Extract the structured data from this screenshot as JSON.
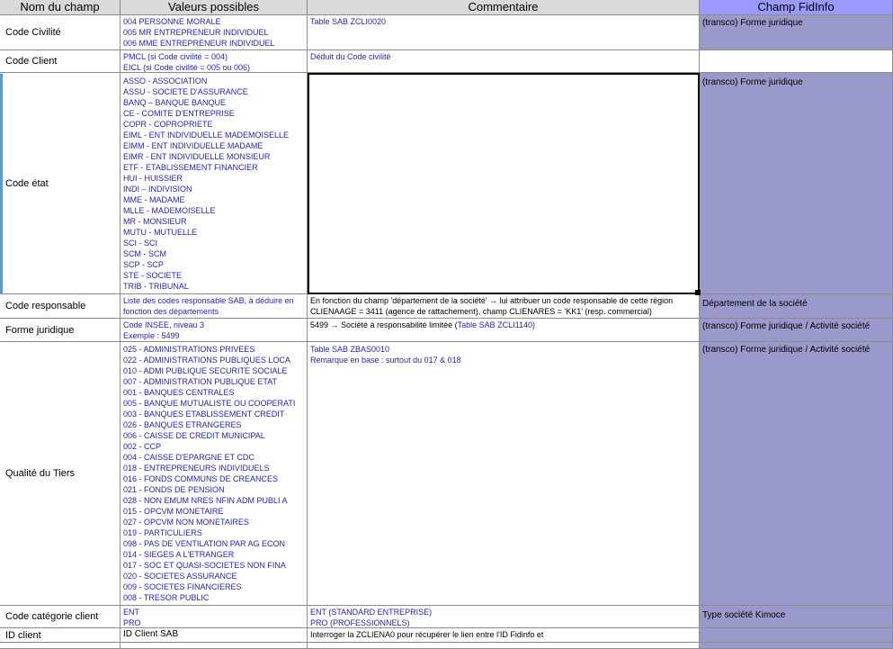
{
  "headers": {
    "name": "Nom du champ",
    "values": "Valeurs possibles",
    "comment": "Commentaire",
    "fidinfo": "Champ FidInfo"
  },
  "rows": {
    "civilite": {
      "name": "Code Civilité",
      "values": [
        "004 PERSONNE MORALE",
        "005 MR ENTREPRENEUR INDIVIDUEL",
        "006 MME ENTREPRENEUR INDIVIDUEL"
      ],
      "comment": "Table SAB ZCLI0020",
      "fidinfo": "(transco) Forme juridique"
    },
    "client": {
      "name": "Code Client",
      "values": [
        "PMCL (si Code civilité = 004)",
        "EICL (si Code civilité = 005 ou 006)"
      ],
      "comment": "Déduit du Code civilité",
      "fidinfo": ""
    },
    "etat": {
      "name": "Code état",
      "values": [
        "ASSO - ASSOCIATION",
        "ASSU - SOCIETE D'ASSURANCE",
        "BANQ – BANQUE BANQUE",
        "CE - COMITE D'ENTREPRISE",
        "COPR - COPROPRIETE",
        "EIML - ENT INDIVIDUELLE MADEMOISELLE",
        "EIMM - ENT INDIVIDUELLE MADAME",
        "EIMR - ENT INDIVIDUELLE MONSIEUR",
        "ETF - ETABLISSEMENT FINANCIER",
        "HUI - HUISSIER",
        "INDI – INDIVISION",
        "MME - MADAME",
        "MLLE - MADEMOISELLE",
        "MR - MONSIEUR",
        "MUTU - MUTUELLE",
        "SCI - SCI",
        "SCM - SCM",
        "SCP - SCP",
        "STE - SOCIETE",
        "TRIB - TRIBUNAL"
      ],
      "comment": "",
      "fidinfo": "(transco) Forme juridique"
    },
    "responsable": {
      "name": "Code responsable",
      "values": [
        "Liste des codes responsable SAB, à déduire en",
        "fonction des départements"
      ],
      "comment_lines": [
        "En fonction du champ 'département de la société' → lui attribuer un code responsable de cette région",
        "CLIENAAGE = 3411 (agence de rattachement), champ CLIENARES = 'KK1' (resp. commercial)"
      ],
      "fidinfo": "Département de la société"
    },
    "forme": {
      "name": "Forme juridique",
      "values": [
        "Code INSEE, niveau 3",
        "Exemple : 5499"
      ],
      "comment_a": "5499 → Société à responsabilité limitée (",
      "comment_b": "Table SAB ZCLI1140)",
      "fidinfo": "(transco) Forme juridique / Activité société"
    },
    "qualite": {
      "name": "Qualité du Tiers",
      "values": [
        "025 - ADMINISTRATIONS PRIVEES",
        "022 - ADMINISTRATIONS PUBLIQUES LOCA",
        "010 - ADMI PUBLIQUE SECURITE SOCIALE",
        "007 - ADMINISTRATION PUBLIQUE ETAT",
        "001 - BANQUES CENTRALES",
        "005 - BANQUE MUTUALISTE OU COOPERATI",
        "003 - BANQUES ETABLISSEMENT CREDIT",
        "026 - BANQUES ETRANGERES",
        "006 - CAISSE DE CREDIT MUNICIPAL",
        "002 - CCP",
        "004 - CAISSE D'EPARGNE ET CDC",
        "018 - ENTREPRENEURS INDIVIDUELS",
        "016 - FONDS COMMUNS DE CREANCES",
        "021 - FONDS DE PENSION",
        "028 - NON EMUM NRES NFIN ADM PUBLI A",
        "015 - OPCVM MONETAIRE",
        "027 - OPCVM NON MONETAIRES",
        "019 - PARTICULIERS",
        "098 - PAS DE VENTILATION PAR AG ECON",
        "014 - SIEGES A L'ETRANGER",
        "017 - SOC ET QUASI-SOCIETES NON FINA",
        "020 - SOCIETES ASSURANCE",
        "009 - SOCIETES FINANCIERES",
        "008 - TRESOR PUBLIC"
      ],
      "comment_lines": [
        "Table SAB ZBAS0010",
        "Remarque en base : surtout du 017 & 018"
      ],
      "fidinfo": "(transco) Forme juridique / Activité société"
    },
    "categorie": {
      "name": "Code catégorie client",
      "values": [
        "ENT",
        "PRO"
      ],
      "comment_lines": [
        "ENT (STANDARD ENTREPRISE)",
        "PRO (PROFESSIONNELS)"
      ],
      "fidinfo": "Type société Kimoce"
    },
    "idclient": {
      "name": "ID client",
      "values": [
        "ID Client SAB"
      ],
      "comment": "Interroger la ZCLIENA0 pour récupérer le lien entre l'ID Fidinfo et",
      "fidinfo": ""
    }
  },
  "colors": {
    "header_bg": "#d9d9d9",
    "fidinfo_header_bg": "#9999ff",
    "fidinfo_fill": "#9999cc",
    "value_text": "#1f1fbf",
    "spellcheck": "#d21e1e"
  }
}
